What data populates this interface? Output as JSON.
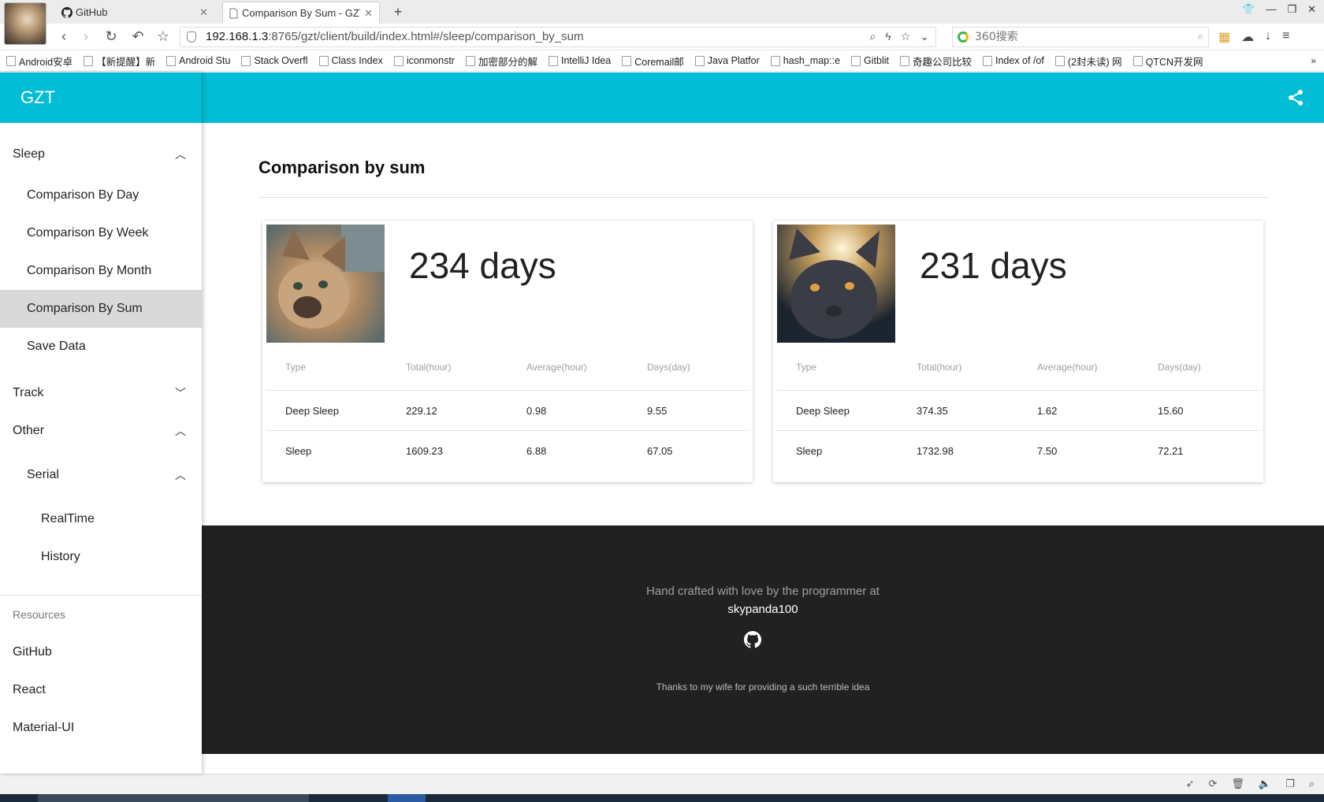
{
  "browser": {
    "tabs": [
      {
        "title": "GitHub"
      },
      {
        "title": "Comparison By Sum - GZT"
      }
    ],
    "url_host": "192.168.1.3",
    "url_rest": ":8765/gzt/client/build/index.html#/sleep/comparison_by_sum",
    "search_placeholder": "360搜索",
    "bookmarks": [
      "Android安卓",
      "【新提醒】新",
      "Android Stu",
      "Stack Overfl",
      "Class Index",
      "iconmonstr",
      "加密部分的解",
      "IntelliJ Idea",
      "Coremail邮",
      "Java Platfor",
      "hash_map::e",
      "Gitblit",
      "奇趣公司比较",
      "Index of /of",
      "(2封未读) 网",
      "QTCN开发网"
    ],
    "bookmarks_more": "»"
  },
  "app": {
    "title": "GZT",
    "accent_color": "#00bcd4"
  },
  "sidebar": {
    "sleep_label": "Sleep",
    "sleep_items": [
      "Comparison By Day",
      "Comparison By Week",
      "Comparison By Month",
      "Comparison By Sum",
      "Save Data"
    ],
    "active_item": "Comparison By Sum",
    "track_label": "Track",
    "other_label": "Other",
    "serial_label": "Serial",
    "serial_items": [
      "RealTime",
      "History"
    ],
    "resources_header": "Resources",
    "resources": [
      "GitHub",
      "React",
      "Material-UI"
    ]
  },
  "main": {
    "title": "Comparison by sum",
    "table_headers": [
      "Type",
      "Total(hour)",
      "Average(hour)",
      "Days(day)"
    ],
    "cards": [
      {
        "days": "234 days",
        "rows": [
          [
            "Deep Sleep",
            "229.12",
            "0.98",
            "9.55"
          ],
          [
            "Sleep",
            "1609.23",
            "6.88",
            "67.05"
          ]
        ]
      },
      {
        "days": "231 days",
        "rows": [
          [
            "Deep Sleep",
            "374.35",
            "1.62",
            "15.60"
          ],
          [
            "Sleep",
            "1732.98",
            "7.50",
            "72.21"
          ]
        ]
      }
    ]
  },
  "footer": {
    "line1": "Hand crafted with love by the programmer at",
    "author": "skypanda100",
    "thanks": "Thanks to my wife for providing a such terrible idea"
  }
}
